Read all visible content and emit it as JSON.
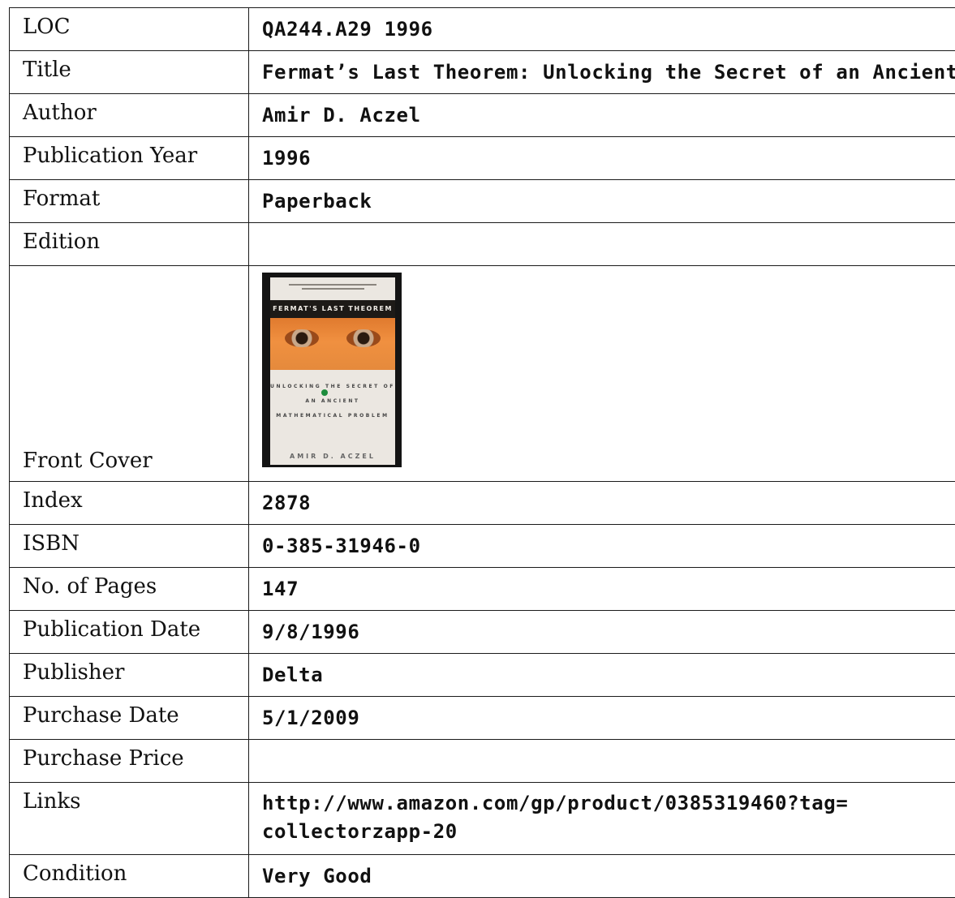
{
  "rows": [
    {
      "label": "LOC",
      "value": "QA244.A29 1996"
    },
    {
      "label": "Title",
      "value": "Fermat’s Last Theorem: Unlocking the Secret of an Ancient"
    },
    {
      "label": "Author",
      "value": "Amir D. Aczel"
    },
    {
      "label": "Publication Year",
      "value": "1996"
    },
    {
      "label": "Format",
      "value": "Paperback"
    },
    {
      "label": "Edition",
      "value": ""
    },
    {
      "label": "Front Cover"
    },
    {
      "label": "Index",
      "value": "2878"
    },
    {
      "label": "ISBN",
      "value": "0-385-31946-0"
    },
    {
      "label": "No. of Pages",
      "value": "147"
    },
    {
      "label": "Publication Date",
      "value": "9/8/1996"
    },
    {
      "label": "Publisher",
      "value": "Delta"
    },
    {
      "label": "Purchase Date",
      "value": "5/1/2009"
    },
    {
      "label": "Purchase Price",
      "value": ""
    },
    {
      "label": "Links",
      "value_lines": [
        "http://www.amazon.com/gp/product/0385319460?tag=",
        "collectorzapp-20"
      ]
    },
    {
      "label": "Condition",
      "value": "Very Good"
    }
  ],
  "cover": {
    "band_title": "FERMAT'S LAST THEOREM",
    "subtitle": "UNLOCKING THE SECRET OF AN ANCIENT MATHEMATICAL PROBLEM",
    "author": "AMIR D. ACZEL"
  }
}
